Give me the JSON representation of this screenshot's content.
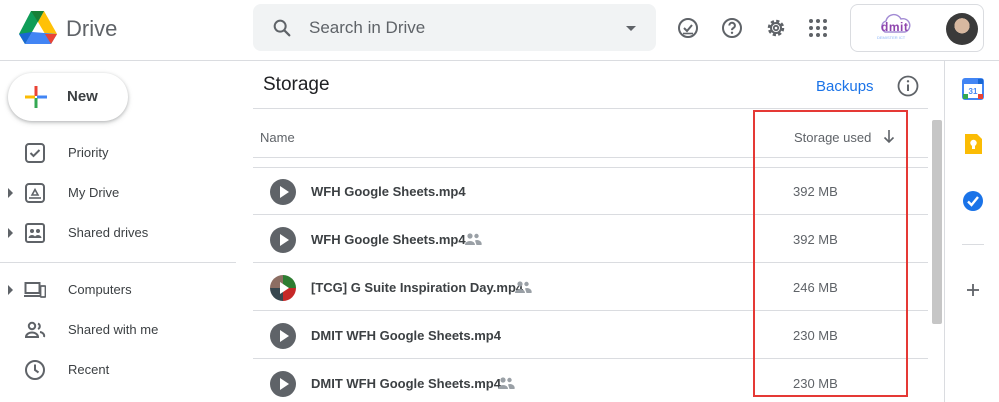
{
  "header": {
    "brand": "Drive",
    "search_placeholder": "Search in Drive",
    "icons": [
      "logo-icon",
      "search-icon",
      "search-options-icon",
      "offline-ready-icon",
      "help-icon",
      "settings-icon",
      "apps-grid-icon",
      "avatar"
    ],
    "org_logo_text": "dmit",
    "org_logo_sub": "DEMISTER ICT"
  },
  "sidebar": {
    "new_label": "New",
    "items": [
      {
        "label": "Priority",
        "icon": "priority-icon",
        "expandable": false
      },
      {
        "label": "My Drive",
        "icon": "my-drive-icon",
        "expandable": true
      },
      {
        "label": "Shared drives",
        "icon": "shared-drives-icon",
        "expandable": true
      },
      {
        "label": "Computers",
        "icon": "computers-icon",
        "expandable": true
      },
      {
        "label": "Shared with me",
        "icon": "shared-with-me-icon",
        "expandable": false
      },
      {
        "label": "Recent",
        "icon": "recent-icon",
        "expandable": false
      }
    ]
  },
  "main": {
    "title": "Storage",
    "backups_link": "Backups",
    "columns": {
      "name": "Name",
      "storage_used": "Storage used"
    },
    "rows": [
      {
        "name": "WFH Google Sheets.mp4",
        "size": "392 MB",
        "shared": false,
        "thumb": "video"
      },
      {
        "name": "WFH Google Sheets.mp4",
        "size": "392 MB",
        "shared": true,
        "thumb": "video"
      },
      {
        "name": "[TCG] G Suite Inspiration Day.mp4",
        "size": "246 MB",
        "shared": true,
        "thumb": "photo"
      },
      {
        "name": "DMIT WFH Google Sheets.mp4",
        "size": "230 MB",
        "shared": false,
        "thumb": "video"
      },
      {
        "name": "DMIT WFH Google Sheets.mp4",
        "size": "230 MB",
        "shared": true,
        "thumb": "video"
      }
    ]
  },
  "side_panel": {
    "icons": [
      "calendar-icon",
      "keep-icon",
      "tasks-icon",
      "add-addon-icon"
    ],
    "calendar_day": "31"
  },
  "colors": {
    "accent_blue": "#1a73e8",
    "highlight_red": "#e53935",
    "border": "#dadce0",
    "text_secondary": "#5f6368"
  }
}
